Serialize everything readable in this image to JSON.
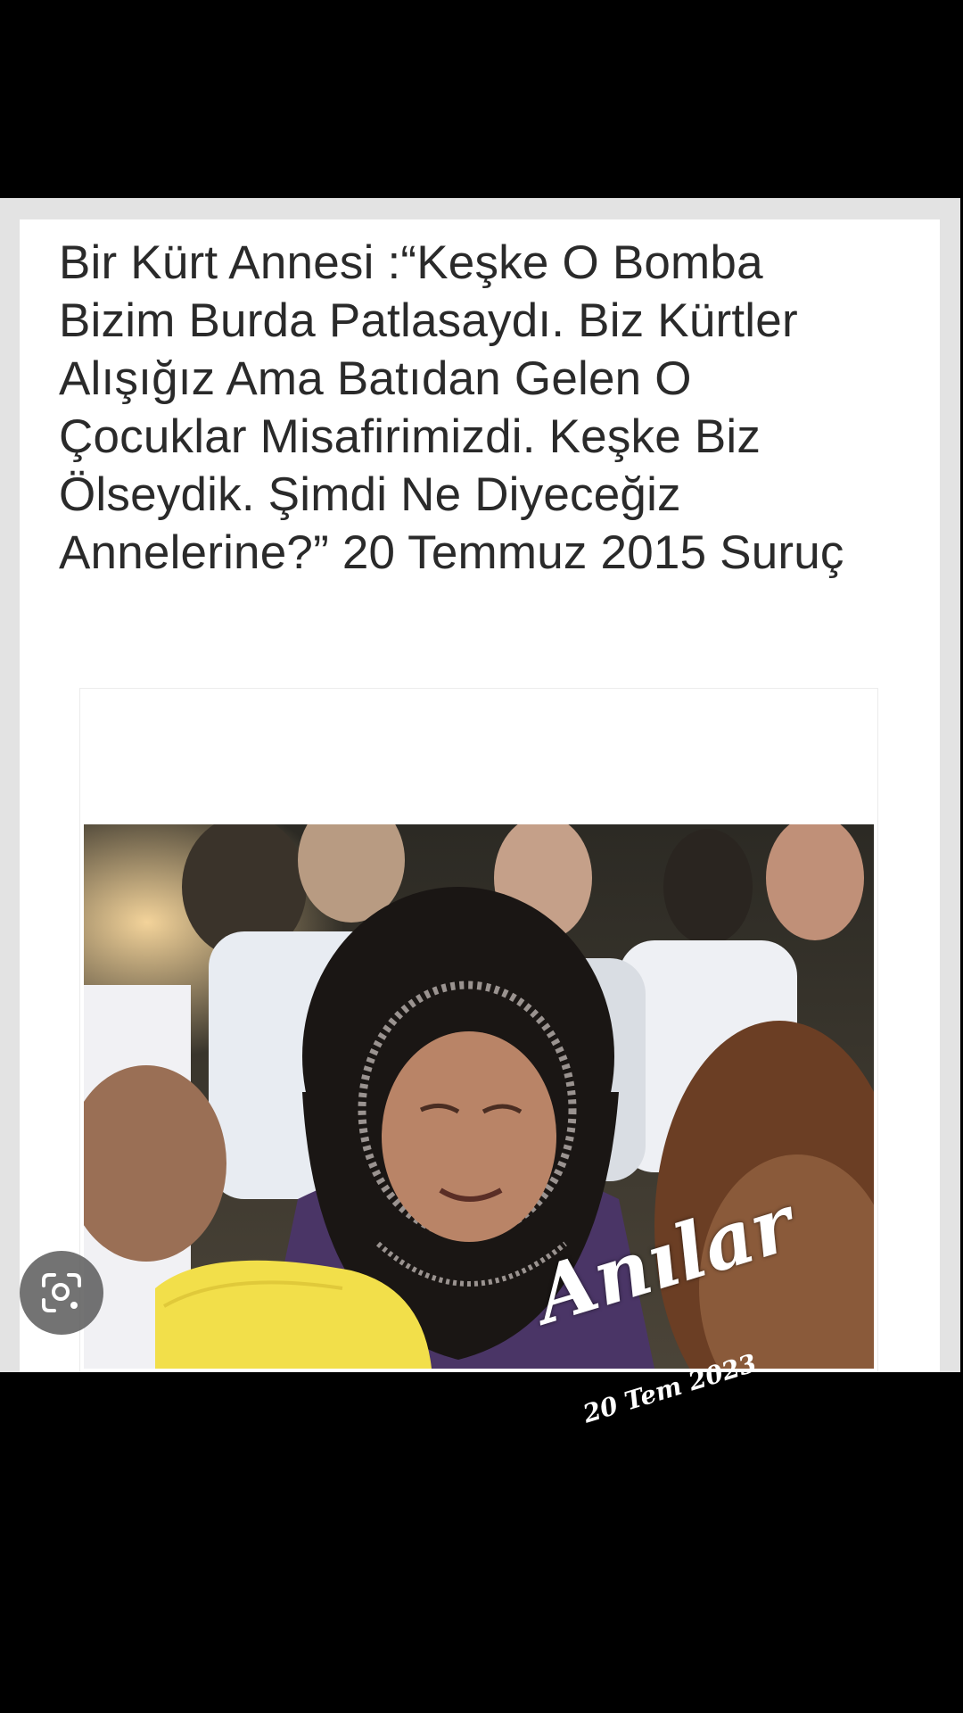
{
  "post": {
    "quote_text": "Bir Kürt Annesi :“Keşke O Bomba Bizim Burda Patlasaydı. Biz Kürtler Alışığız Ama Batıdan Gelen O Çocuklar Misafirimizdi. Keşke Biz Ölseydik. Şimdi Ne Diyeceğiz Annelerine?” 20 Temmuz 2015 Suruç",
    "photo_alt": "Ağlayan başörtülü kadın"
  },
  "overlay": {
    "watermark_title": "Anılar",
    "watermark_date": "20 Tem 2023",
    "lens_icon": "lens-search-icon"
  },
  "colors": {
    "background": "#000000",
    "card": "#ffffff",
    "text": "#2a2a2a",
    "lens_button": "#5a5a5a"
  }
}
